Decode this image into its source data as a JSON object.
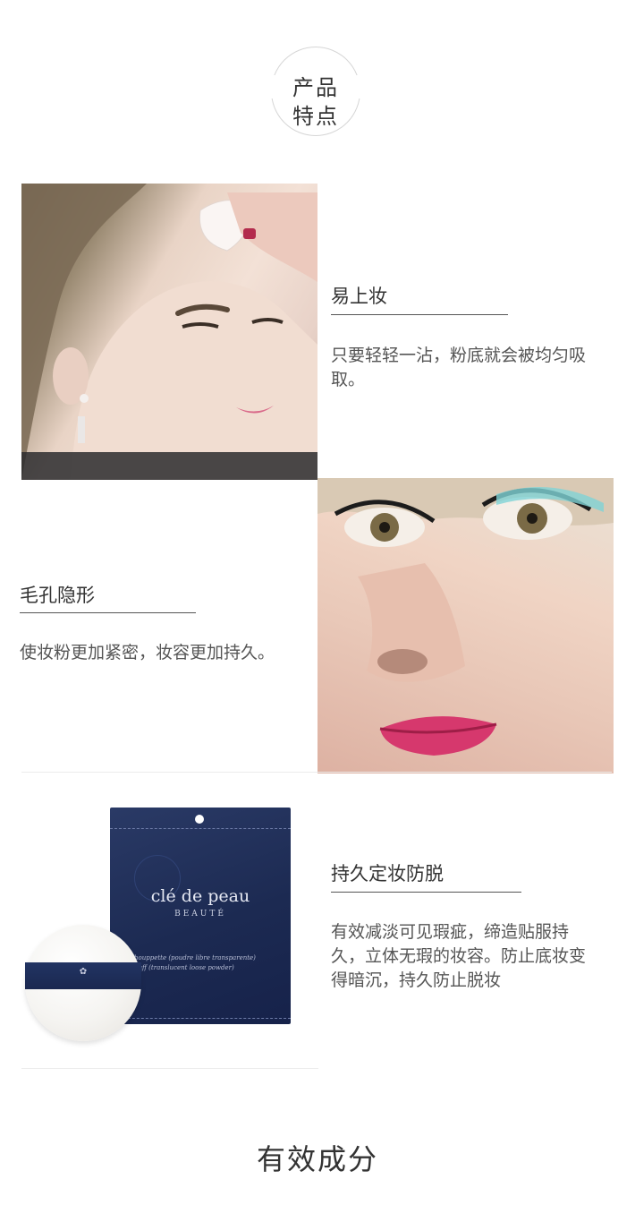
{
  "header": {
    "badge_line1": "产品",
    "badge_line2": "特点"
  },
  "features": [
    {
      "title": "易上妆",
      "description": "只要轻轻一沾，粉底就会被均匀吸取。"
    },
    {
      "title": "毛孔隐形",
      "description": "使妆粉更加紧密，妆容更加持久。"
    },
    {
      "title": "持久定妆防脱",
      "description": "有效减淡可见瑕疵，缔造贴服持久，立体无瑕的妆容。防止底妆变得暗沉，持久防止脱妆"
    }
  ],
  "product": {
    "brand": "clé de peau",
    "brand_sub": "BEAUTÉ",
    "label_line1": "houppette (poudre libre transparente)",
    "label_line2": "puff (translucent loose powder)"
  },
  "footer": {
    "heading": "有效成分"
  },
  "colors": {
    "text": "#333333",
    "pouch_navy": "#1c2a52"
  }
}
